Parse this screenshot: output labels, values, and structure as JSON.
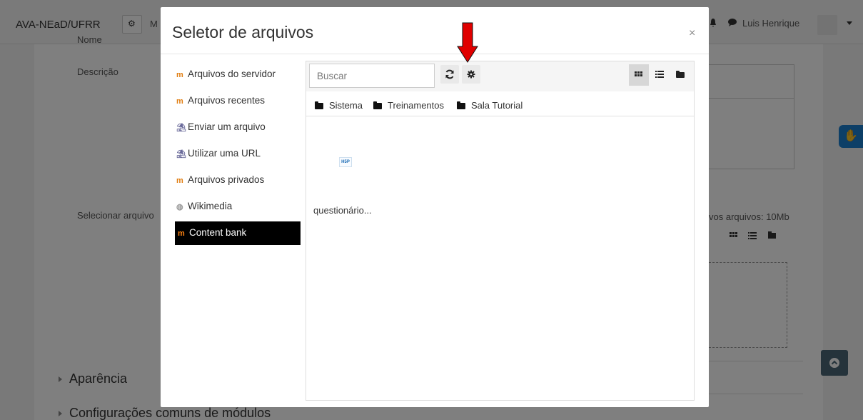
{
  "navbar": {
    "brand": "AVA-NEaD/UFRR",
    "menu_letter": "M",
    "user_name": "Luis Henrique"
  },
  "page": {
    "label_nome": "Nome",
    "label_descricao": "Descrição",
    "label_selecionar": "Selecionar arquivo",
    "max_size_text": "vos arquivos: 10Mb",
    "section_aparencia": "Aparência",
    "section_config": "Configurações comuns de módulos"
  },
  "modal": {
    "title": "Seletor de arquivos",
    "close": "×",
    "repositories": [
      {
        "label": "Arquivos do servidor",
        "icon": "moodle-icon"
      },
      {
        "label": "Arquivos recentes",
        "icon": "moodle-icon"
      },
      {
        "label": "Enviar um arquivo",
        "icon": "upload-icon"
      },
      {
        "label": "Utilizar uma URL",
        "icon": "url-icon"
      },
      {
        "label": "Arquivos privados",
        "icon": "moodle-icon"
      },
      {
        "label": "Wikimedia",
        "icon": "wikimedia-icon"
      },
      {
        "label": "Content bank",
        "icon": "moodle-icon",
        "active": true
      }
    ],
    "search_placeholder": "Buscar",
    "path": [
      "Sistema",
      "Treinamentos",
      "Sala Tutorial"
    ],
    "files": [
      {
        "name": "questionário...",
        "type": "H5P"
      }
    ]
  },
  "colors": {
    "arrow": "#e00000",
    "active_repo_bg": "#000000",
    "accessibility_button": "#1a7fcf"
  }
}
